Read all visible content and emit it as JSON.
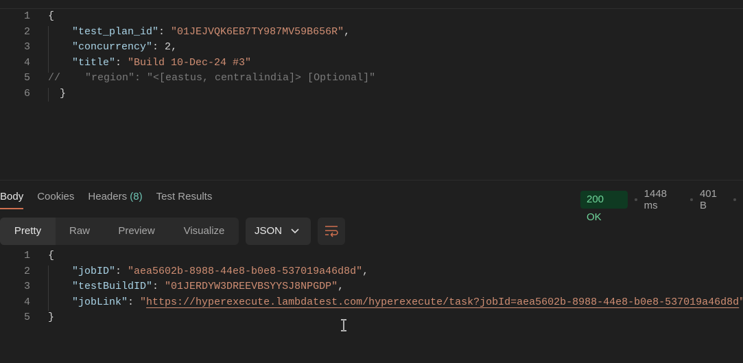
{
  "request_body": {
    "lines": [
      {
        "num": "1"
      },
      {
        "num": "2"
      },
      {
        "num": "3"
      },
      {
        "num": "4"
      },
      {
        "num": "5"
      },
      {
        "num": "6"
      }
    ],
    "open_brace": "{",
    "close_brace": "}",
    "test_plan_id_key": "\"test_plan_id\"",
    "test_plan_id_value": "\"01JEJVQK6EB7TY987MV59B656R\"",
    "concurrency_key": "\"concurrency\"",
    "concurrency_value": "2",
    "title_key": "\"title\"",
    "title_value": "\"Build 10-Dec-24 #3\"",
    "comment_line": "//    \"region\": \"<[eastus, centralindia]> [Optional]\""
  },
  "response_tabs": {
    "body": "Body",
    "cookies": "Cookies",
    "headers": "Headers",
    "headers_count": "(8)",
    "test_results": "Test Results"
  },
  "status": {
    "code": "200 OK",
    "time": "1448 ms",
    "size": "401 B",
    "colors": {
      "ok_bg": "#0f3a22",
      "ok_text": "#6fd59a"
    }
  },
  "view_modes": {
    "pretty": "Pretty",
    "raw": "Raw",
    "preview": "Preview",
    "visualize": "Visualize"
  },
  "format_select": {
    "value": "JSON"
  },
  "response_body": {
    "lines": [
      {
        "num": "1"
      },
      {
        "num": "2"
      },
      {
        "num": "3"
      },
      {
        "num": "4"
      },
      {
        "num": "5"
      }
    ],
    "open_brace": "{",
    "close_brace": "}",
    "jobID_key": "\"jobID\"",
    "jobID_value": "\"aea5602b-8988-44e8-b0e8-537019a46d8d\"",
    "testBuildID_key": "\"testBuildID\"",
    "testBuildID_value": "\"01JERDYW3DREEVBSYYSJ8NPGDP\"",
    "jobLink_key": "\"jobLink\"",
    "jobLink_value": "https://hyperexecute.lambdatest.com/hyperexecute/task?jobId=aea5602b-8988-44e8-b0e8-537019a46d8d"
  }
}
